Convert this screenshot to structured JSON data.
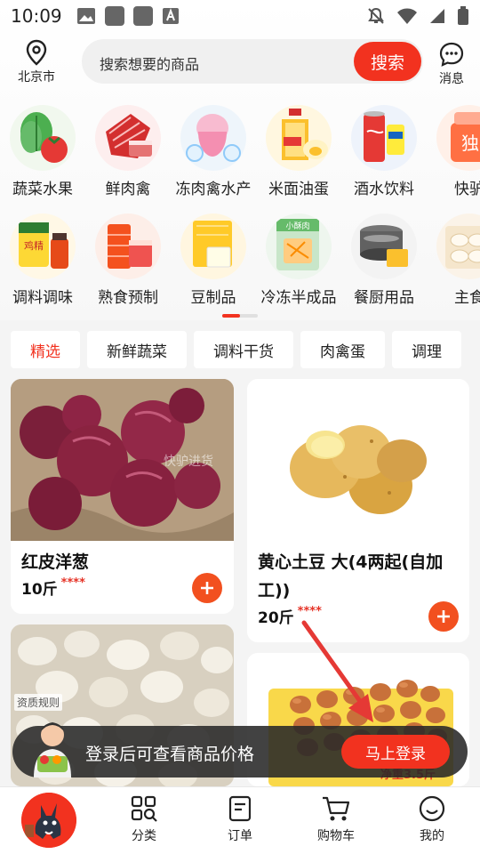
{
  "status_bar": {
    "time": "10:09"
  },
  "header": {
    "location_label": "北京市",
    "search_placeholder": "搜索想要的商品",
    "search_button": "搜索",
    "messages_label": "消息"
  },
  "categories": {
    "row1": [
      "蔬菜水果",
      "鲜肉禽",
      "冻肉禽水产",
      "米面油蛋",
      "酒水饮料",
      "快驴"
    ],
    "row2": [
      "调料调味",
      "熟食预制",
      "豆制品",
      "冷冻半成品",
      "餐厨用品",
      "主食"
    ]
  },
  "tabs": [
    "精选",
    "新鲜蔬菜",
    "调料干货",
    "肉禽蛋",
    "调理"
  ],
  "products": {
    "p1": {
      "name": "红皮洋葱",
      "price": "10斤",
      "stars": "****",
      "watermark": "快驴进货"
    },
    "p2": {
      "name": "黄心土豆 大(4两起(自加工))",
      "price": "20斤",
      "stars": "****"
    },
    "p3": {
      "badge": "资质规则"
    },
    "p4": {
      "tag": "净重3.5斤"
    }
  },
  "login_banner": {
    "text": "登录后可查看商品价格",
    "button": "马上登录"
  },
  "bottom_nav": {
    "category": "分类",
    "orders": "订单",
    "cart": "购物车",
    "mine": "我的"
  },
  "colors": {
    "accent": "#f2321f",
    "annotation_arrow": "#e53935"
  }
}
